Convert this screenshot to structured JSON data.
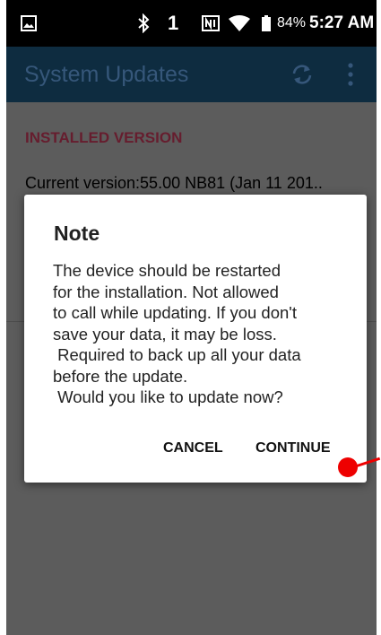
{
  "status_bar": {
    "bluetooth_icon": "bluetooth-icon",
    "sim_indicator": "1",
    "nfc_icon": "nfc-icon",
    "wifi_icon": "wifi-icon",
    "battery_icon": "battery-icon",
    "battery_percent": "84%",
    "time": "5:27 AM"
  },
  "app_bar": {
    "title": "System Updates",
    "refresh_icon": "refresh-icon",
    "more_icon": "more-vert-icon"
  },
  "content": {
    "section_header": "INSTALLED VERSION",
    "current_version": "Current version:55.00 NB81 (Jan 11 201.."
  },
  "dialog": {
    "title": "Note",
    "message": "The device should be restarted\nfor the installation. Not allowed\nto call while updating. If you don't\nsave your data, it may be loss.\n Required to back up all your data\nbefore the update.\n Would you like to update now?",
    "cancel_label": "CANCEL",
    "continue_label": "CONTINUE"
  },
  "colors": {
    "status_bar": "#000000",
    "app_bar": "#0e2c40",
    "scrim_content": "#5c5c5c",
    "section_header": "#661d2e",
    "marker": "#ee0000"
  }
}
